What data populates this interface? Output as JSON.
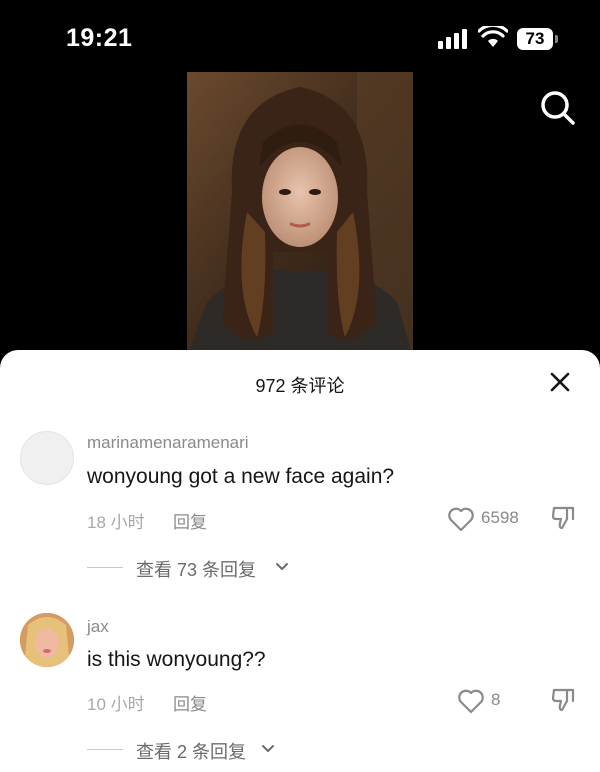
{
  "status_bar": {
    "time": "19:21",
    "battery": "73"
  },
  "comments_sheet": {
    "title": "972 条评论",
    "comments": [
      {
        "username": "marinamenaramenari",
        "text": "wonyoung got a new face again?",
        "time": "18 小时",
        "reply_label": "回复",
        "likes": "6598",
        "view_replies": "查看 73 条回复"
      },
      {
        "username": "jax",
        "text": "is this wonyoung??",
        "time": "10 小时",
        "reply_label": "回复",
        "likes": "8",
        "view_replies": "查看 2 条回复"
      }
    ]
  },
  "colors": {
    "background": "#000000",
    "sheet": "#ffffff",
    "secondary_text": "#8a8a8a"
  },
  "icons": [
    "signal-icon",
    "wifi-icon",
    "battery-icon",
    "search-icon",
    "close-icon",
    "heart-icon",
    "dislike-icon",
    "chevron-down-icon"
  ]
}
